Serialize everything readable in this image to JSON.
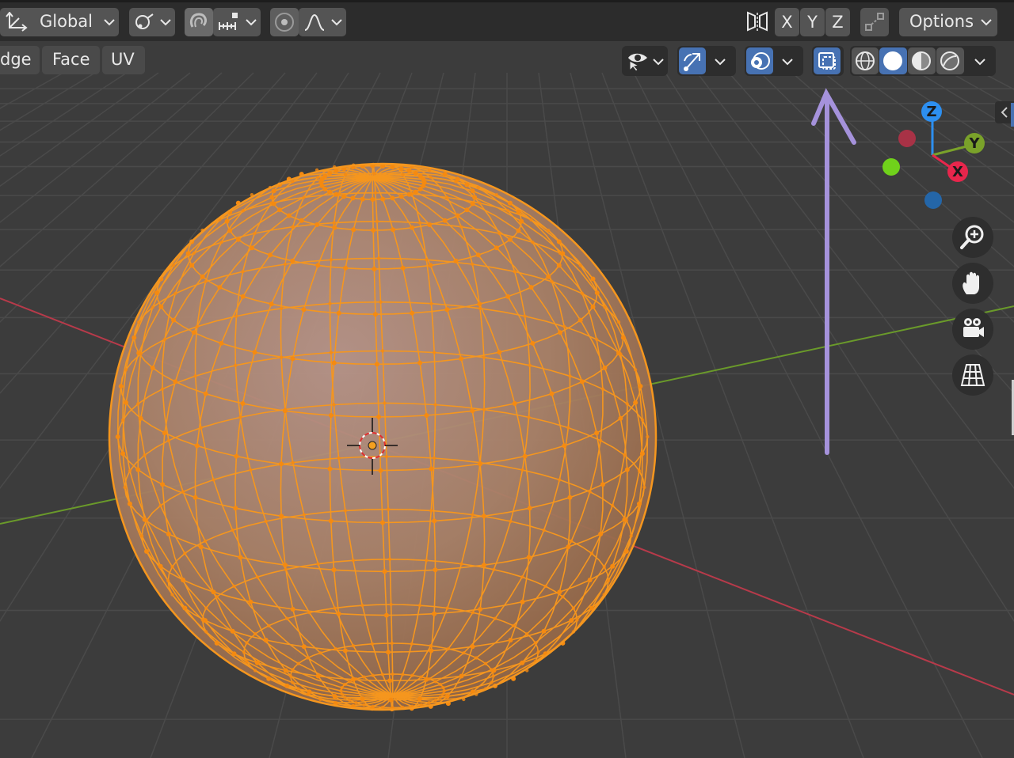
{
  "header": {
    "transform_orientation": "Global",
    "mirror_axes": [
      "X",
      "Y",
      "Z"
    ],
    "options_label": "Options"
  },
  "select_mode_tabs": [
    "dge",
    "Face",
    "UV"
  ],
  "gizmo_axes": {
    "z": "Z",
    "y": "Y",
    "x": "X"
  },
  "colors": {
    "header_bg": "#2c2c2c",
    "viewport_bg": "#3c3c3c",
    "button_bg": "#545454",
    "active_blue": "#4772b3",
    "mesh_orange": "#f5961e",
    "axis_red": "#b73a4a",
    "axis_green": "#6a9a2a",
    "annotation_purple": "#a592db",
    "gizmo_z": "#2d8ff0",
    "gizmo_y": "#7aa22a",
    "gizmo_x": "#e8264c"
  },
  "icons": [
    "transform-orientation-icon",
    "pivot-point-icon",
    "snap-icon",
    "snap-increment-icon",
    "proportional-editing-icon",
    "falloff-curve-icon",
    "mirror-butterfly-icon",
    "auto-merge-icon",
    "visibility-icon",
    "gizmo-icon",
    "overlays-icon",
    "xray-icon",
    "wireframe-shading-icon",
    "solid-shading-icon",
    "material-preview-icon",
    "rendered-shading-icon",
    "zoom-icon",
    "hand-pan-icon",
    "camera-icon",
    "ortho-grid-icon",
    "sidebar-toggle-icon",
    "annotation-arrow",
    "3d-cursor",
    "origin-dot"
  ]
}
